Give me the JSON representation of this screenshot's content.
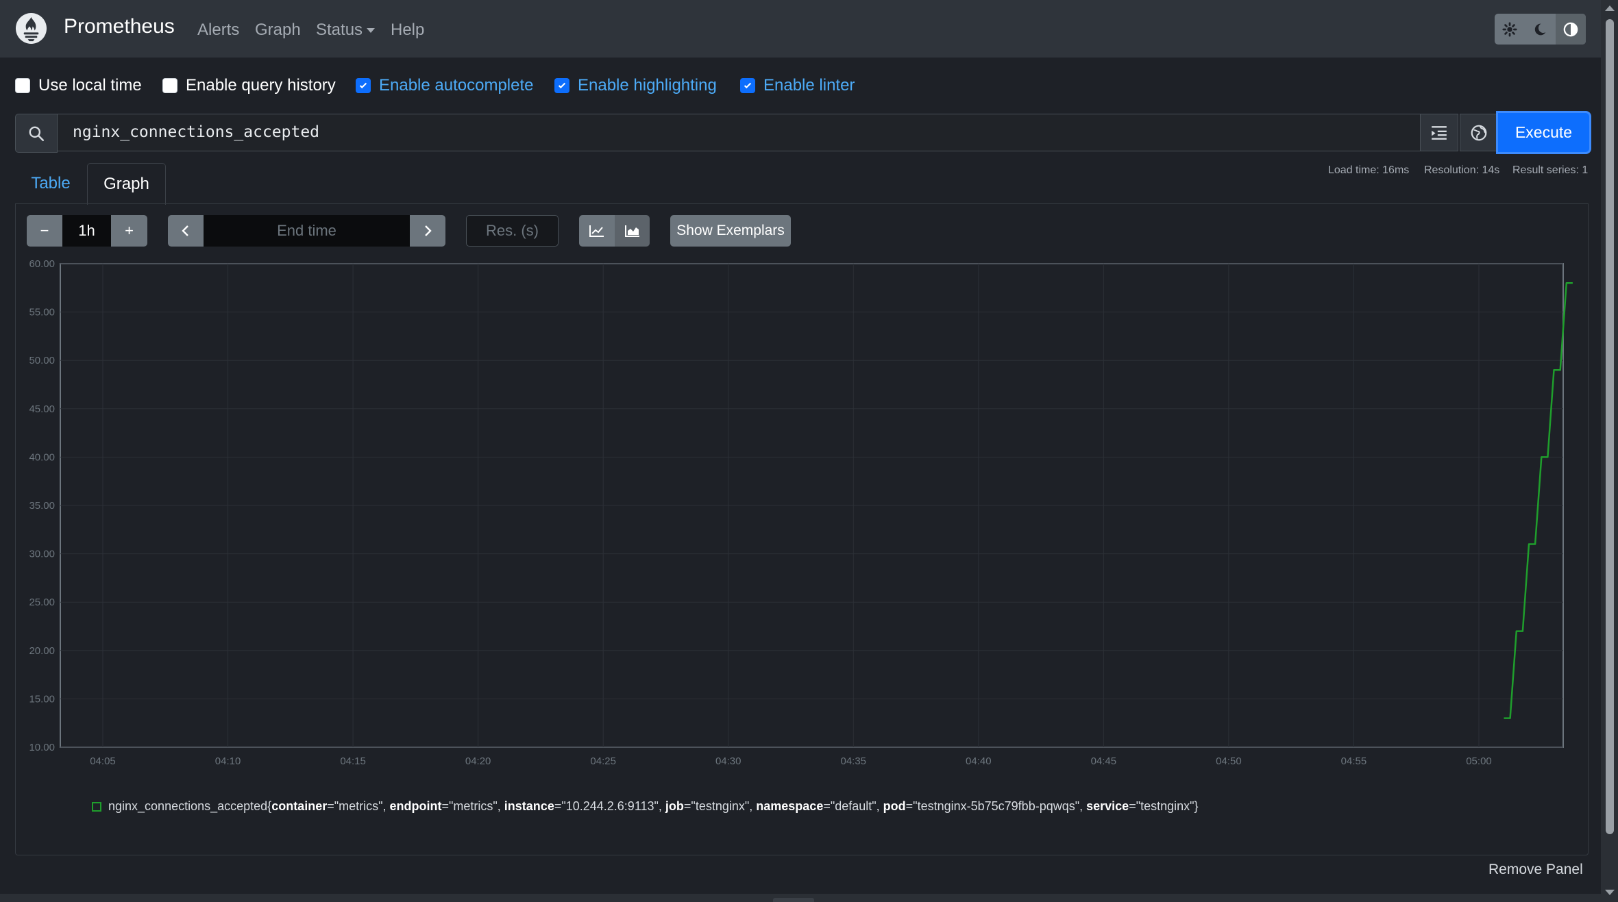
{
  "navbar": {
    "brand": "Prometheus",
    "links": [
      "Alerts",
      "Graph",
      "Status",
      "Help"
    ],
    "theme_buttons": [
      "gear-icon",
      "moon-icon",
      "contrast-icon"
    ]
  },
  "options": [
    {
      "label": "Use local time",
      "checked": false
    },
    {
      "label": "Enable query history",
      "checked": false
    },
    {
      "label": "Enable autocomplete",
      "checked": true
    },
    {
      "label": "Enable highlighting",
      "checked": true
    },
    {
      "label": "Enable linter",
      "checked": true
    }
  ],
  "query": {
    "expression": "nginx_connections_accepted",
    "execute_label": "Execute"
  },
  "stats": {
    "load_time": "Load time: 16ms",
    "resolution": "Resolution: 14s",
    "result_series": "Result series: 1"
  },
  "tabs": [
    "Table",
    "Graph"
  ],
  "controls": {
    "minus": "−",
    "range": "1h",
    "plus": "+",
    "end_time_placeholder": "End time",
    "res_placeholder": "Res. (s)",
    "show_exemplars": "Show Exemplars"
  },
  "chart_data": {
    "type": "line",
    "title": "",
    "xlabel": "",
    "ylabel": "",
    "ylim": [
      10,
      60
    ],
    "yticks": [
      "60.00",
      "55.00",
      "50.00",
      "45.00",
      "40.00",
      "35.00",
      "30.00",
      "25.00",
      "20.00",
      "15.00",
      "10.00"
    ],
    "xticks": [
      "04:05",
      "04:10",
      "04:15",
      "04:20",
      "04:25",
      "04:30",
      "04:35",
      "04:40",
      "04:45",
      "04:50",
      "04:55",
      "05:00"
    ],
    "grid": true,
    "series": [
      {
        "name": "nginx_connections_accepted",
        "color": "#1f9e2c",
        "points": [
          [
            "05:01:00",
            13
          ],
          [
            "05:01:15",
            13
          ],
          [
            "05:01:30",
            22
          ],
          [
            "05:01:45",
            22
          ],
          [
            "05:02:00",
            31
          ],
          [
            "05:02:15",
            31
          ],
          [
            "05:02:30",
            40
          ],
          [
            "05:02:45",
            40
          ],
          [
            "05:03:00",
            49
          ],
          [
            "05:03:15",
            49
          ],
          [
            "05:03:30",
            58
          ],
          [
            "05:03:45",
            58
          ]
        ]
      }
    ]
  },
  "legend": {
    "metric": "nginx_connections_accepted",
    "labels": [
      {
        "key": "container",
        "value": "\"metrics\""
      },
      {
        "key": "endpoint",
        "value": "\"metrics\""
      },
      {
        "key": "instance",
        "value": "\"10.244.2.6:9113\""
      },
      {
        "key": "job",
        "value": "\"testnginx\""
      },
      {
        "key": "namespace",
        "value": "\"default\""
      },
      {
        "key": "pod",
        "value": "\"testnginx-5b75c79fbb-pqwqs\""
      },
      {
        "key": "service",
        "value": "\"testnginx\""
      }
    ]
  },
  "remove_panel": "Remove Panel"
}
